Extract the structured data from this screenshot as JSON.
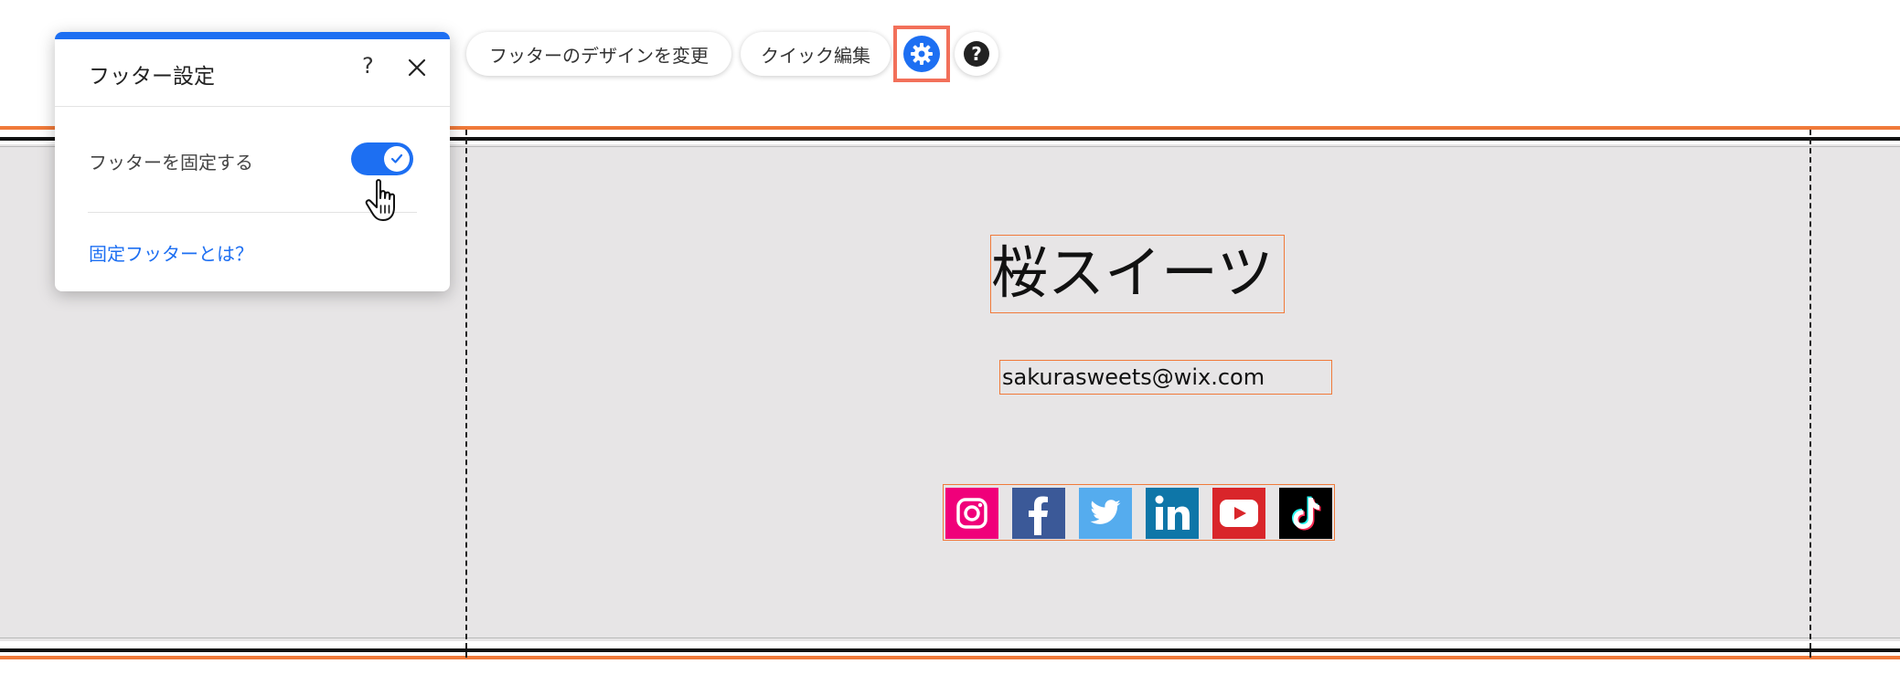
{
  "toolbar": {
    "change_design_label": "フッターのデザインを変更",
    "quick_edit_label": "クイック編集",
    "settings_icon": "gear-icon",
    "help_icon": "question-icon"
  },
  "settings_panel": {
    "title": "フッター設定",
    "help_icon": "?",
    "close_icon": "close-icon",
    "toggle_label": "フッターを固定する",
    "toggle_on": true,
    "link_text": "固定フッターとは？"
  },
  "footer": {
    "site_title": "桜スイーツ",
    "email": "sakurasweets@wix.com",
    "social_icons": [
      "instagram-icon",
      "facebook-icon",
      "twitter-icon",
      "linkedin-icon",
      "youtube-icon",
      "tiktok-icon"
    ]
  },
  "colors": {
    "accent": "#1d6ff2",
    "selection": "#f07a3a",
    "footer_bg": "#e7e5e6",
    "instagram": "#f0007a",
    "facebook": "#3b5998",
    "twitter": "#55acee",
    "linkedin": "#0e76a8",
    "youtube": "#d9252a",
    "tiktok": "#000000"
  }
}
